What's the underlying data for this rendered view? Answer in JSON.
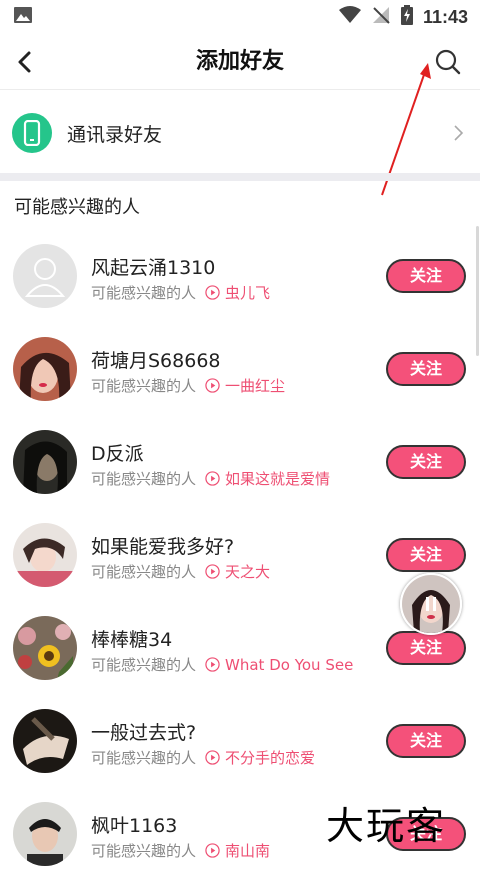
{
  "status_bar": {
    "time": "11:43"
  },
  "header": {
    "title": "添加好友"
  },
  "contacts": {
    "label": "通讯录好友"
  },
  "section": {
    "title": "可能感兴趣的人"
  },
  "people": [
    {
      "name": "风起云涌1310",
      "reason": "可能感兴趣的人",
      "song": "虫儿飞",
      "follow_label": "关注"
    },
    {
      "name": "荷塘月S68668",
      "reason": "可能感兴趣的人",
      "song": "一曲红尘",
      "follow_label": "关注"
    },
    {
      "name": "D反派",
      "reason": "可能感兴趣的人",
      "song": "如果这就是爱情",
      "follow_label": "关注"
    },
    {
      "name": "如果能爱我多好?",
      "reason": "可能感兴趣的人",
      "song": "天之大",
      "follow_label": "关注"
    },
    {
      "name": "棒棒糖34",
      "reason": "可能感兴趣的人",
      "song": "What Do You See",
      "follow_label": "关注"
    },
    {
      "name": "一般过去式?",
      "reason": "可能感兴趣的人",
      "song": "不分手的恋爱",
      "follow_label": "关注"
    },
    {
      "name": "枫叶1163",
      "reason": "可能感兴趣的人",
      "song": "南山南",
      "follow_label": "关注"
    }
  ],
  "watermark": {
    "text": "大玩客"
  },
  "colors": {
    "accent": "#f4517a",
    "contacts_icon": "#25c58b",
    "song_text": "#ee4f73",
    "annotation_arrow": "#e02020"
  }
}
